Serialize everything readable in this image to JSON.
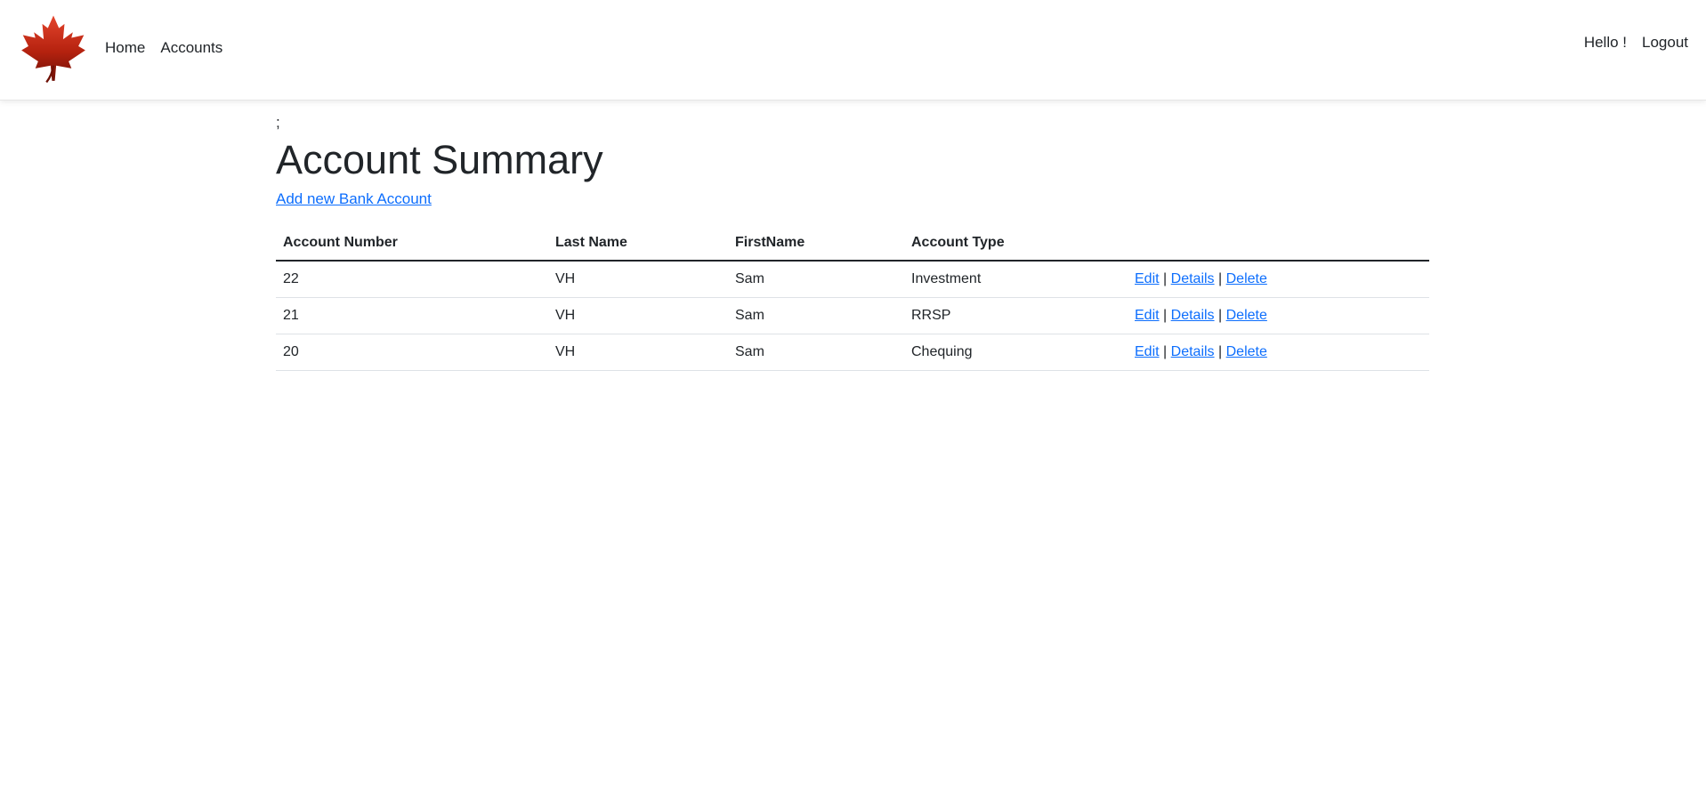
{
  "navbar": {
    "brand_logo": "maple-leaf-logo",
    "links": [
      {
        "label": "Home"
      },
      {
        "label": "Accounts"
      }
    ],
    "greeting": "Hello !",
    "logout": "Logout"
  },
  "main": {
    "stray_text": ";",
    "title": "Account Summary",
    "add_link": "Add new Bank Account",
    "table": {
      "headers": [
        "Account Number",
        "Last Name",
        "FirstName",
        "Account Type",
        ""
      ],
      "rows": [
        {
          "account_number": "22",
          "last_name": "VH",
          "first_name": "Sam",
          "account_type": "Investment"
        },
        {
          "account_number": "21",
          "last_name": "VH",
          "first_name": "Sam",
          "account_type": "RRSP"
        },
        {
          "account_number": "20",
          "last_name": "VH",
          "first_name": "Sam",
          "account_type": "Chequing"
        }
      ],
      "actions": {
        "edit": "Edit",
        "details": "Details",
        "delete": "Delete",
        "separator": "|"
      }
    }
  },
  "colors": {
    "link": "#0d6efd",
    "text": "#212529",
    "leaf_red": "#c62a1b",
    "leaf_dark": "#6e1006"
  }
}
